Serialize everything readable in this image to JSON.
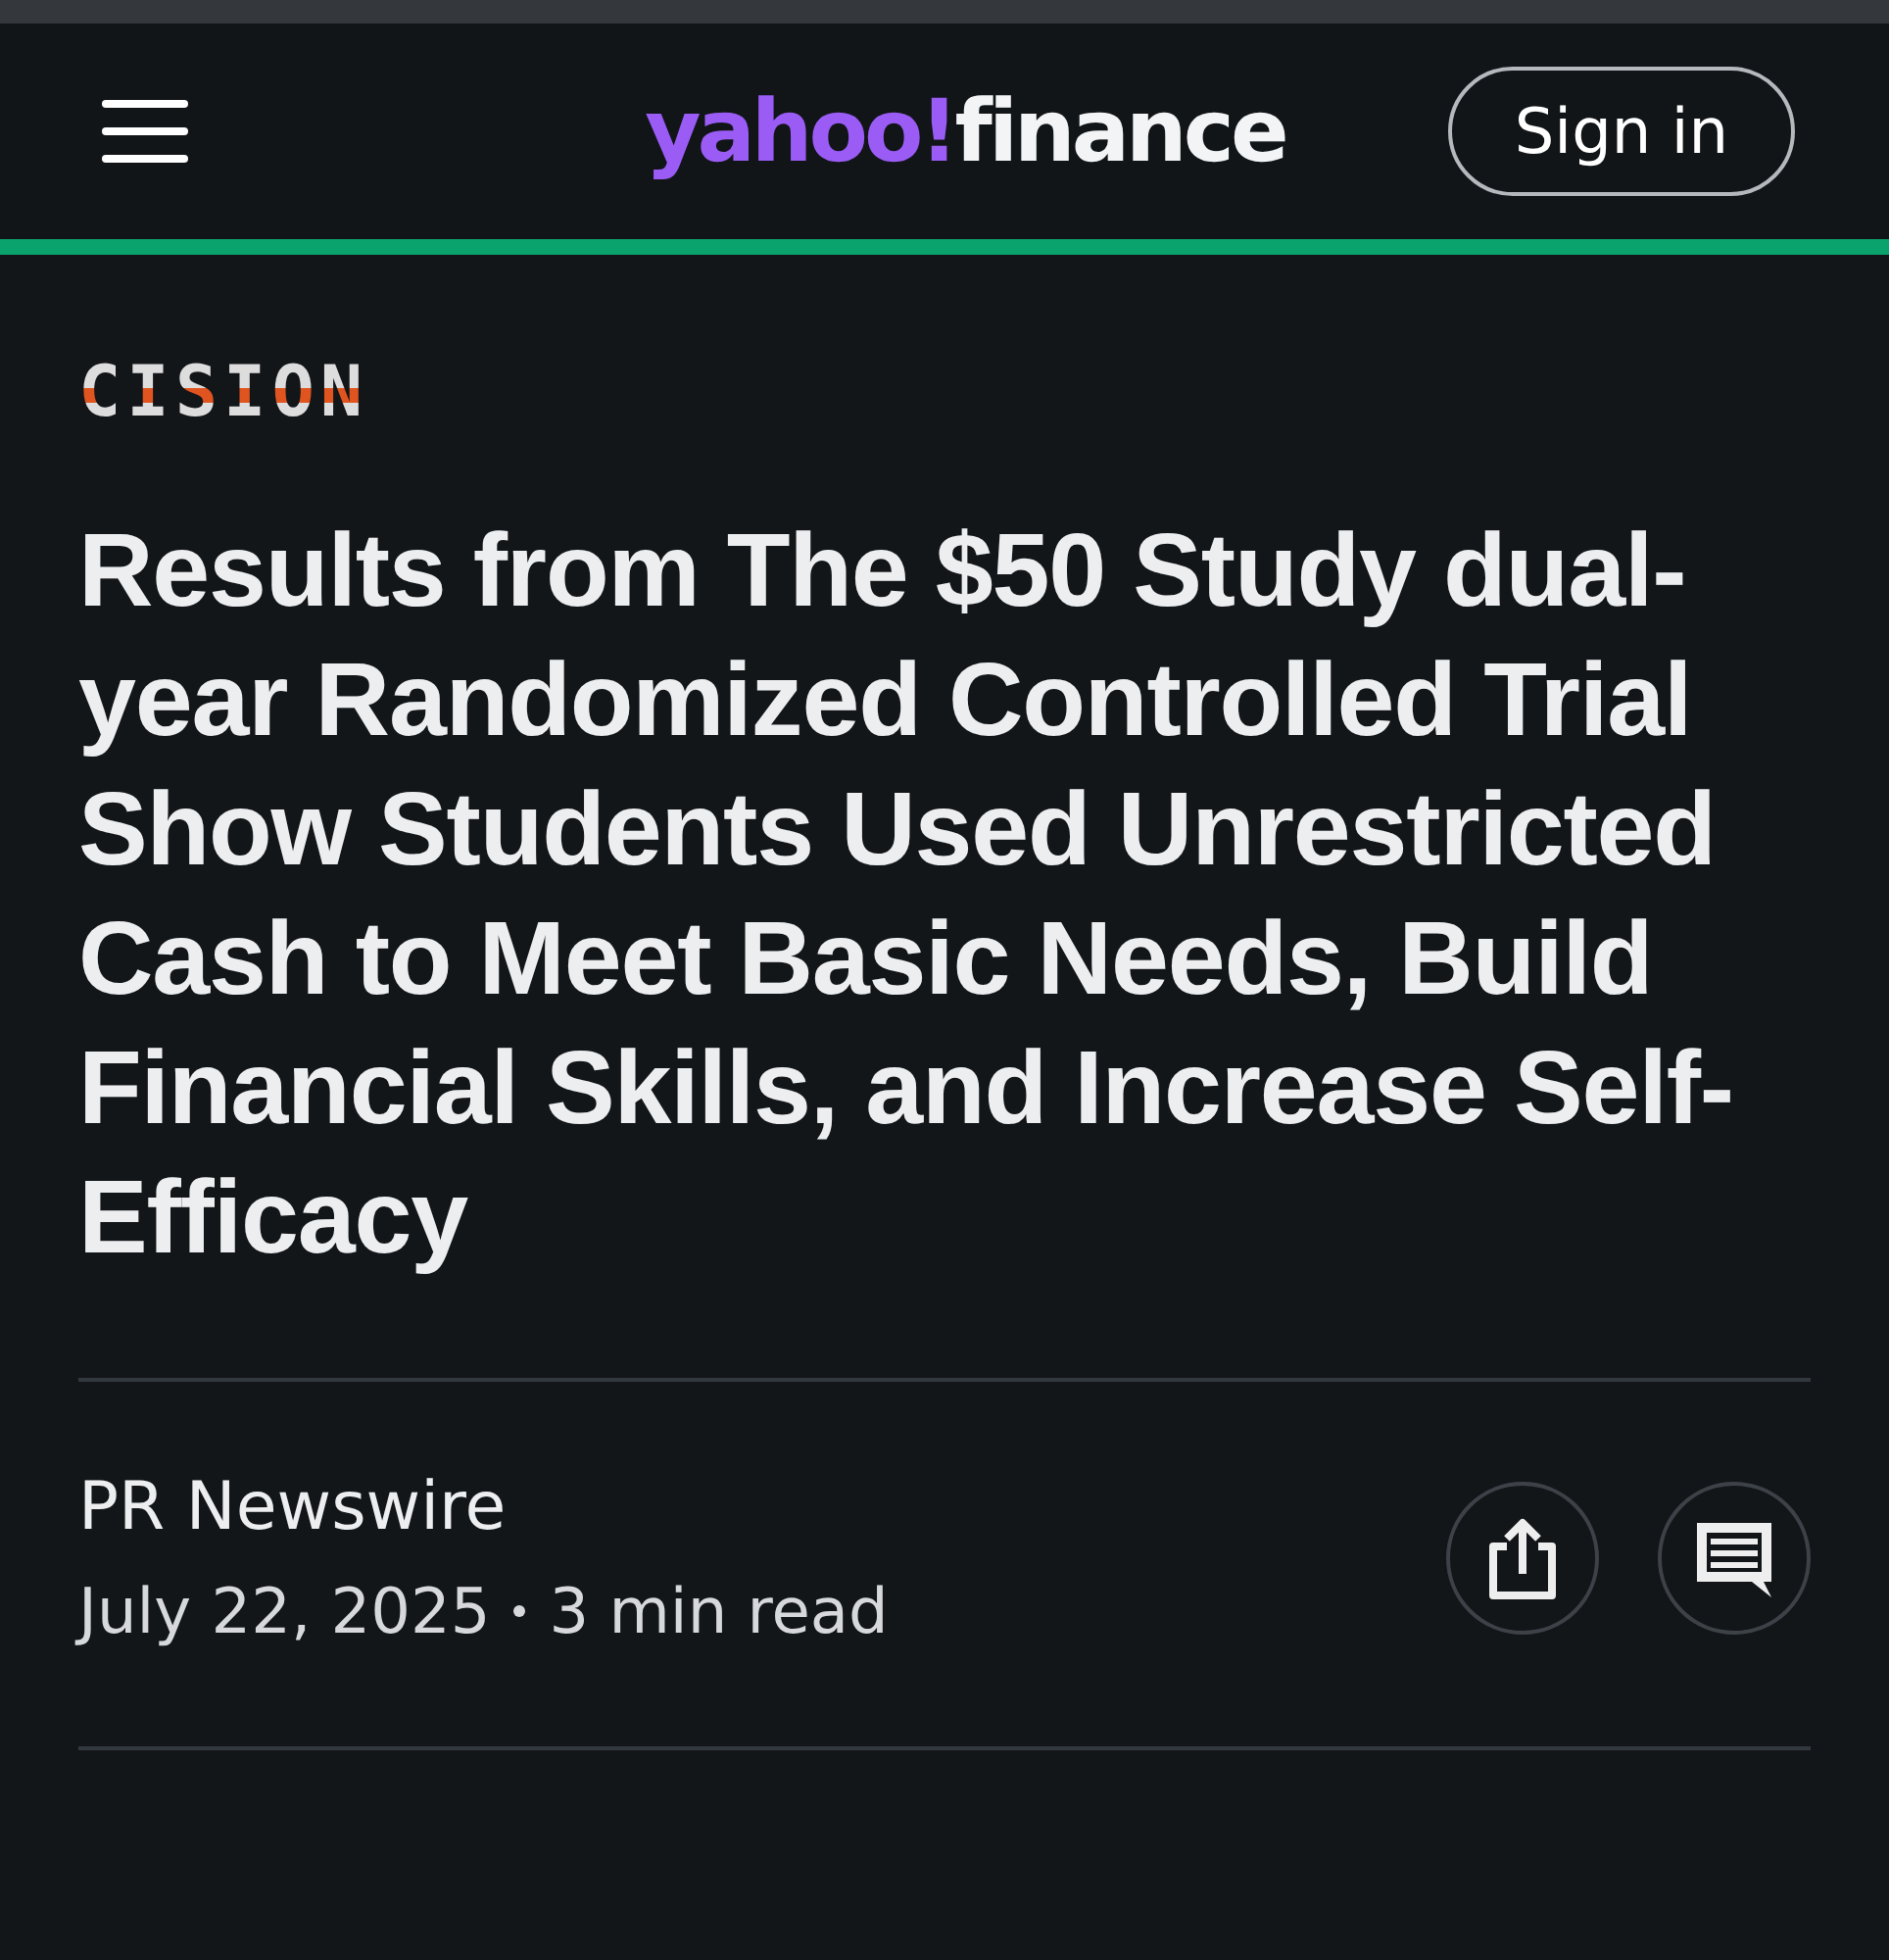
{
  "header": {
    "logo_brand": "yahoo!",
    "logo_section": "finance",
    "sign_in": "Sign in"
  },
  "article": {
    "source_logo": "CISION",
    "headline": "Results from The $50 Study dual-year Randomized Controlled Trial Show Students Used Unrestricted Cash to Meet Basic Needs, Build Financial Skills, and Increase Self-Efficacy",
    "publisher": "PR Newswire",
    "date": "July 22, 2025",
    "read_time": "3 min read"
  }
}
